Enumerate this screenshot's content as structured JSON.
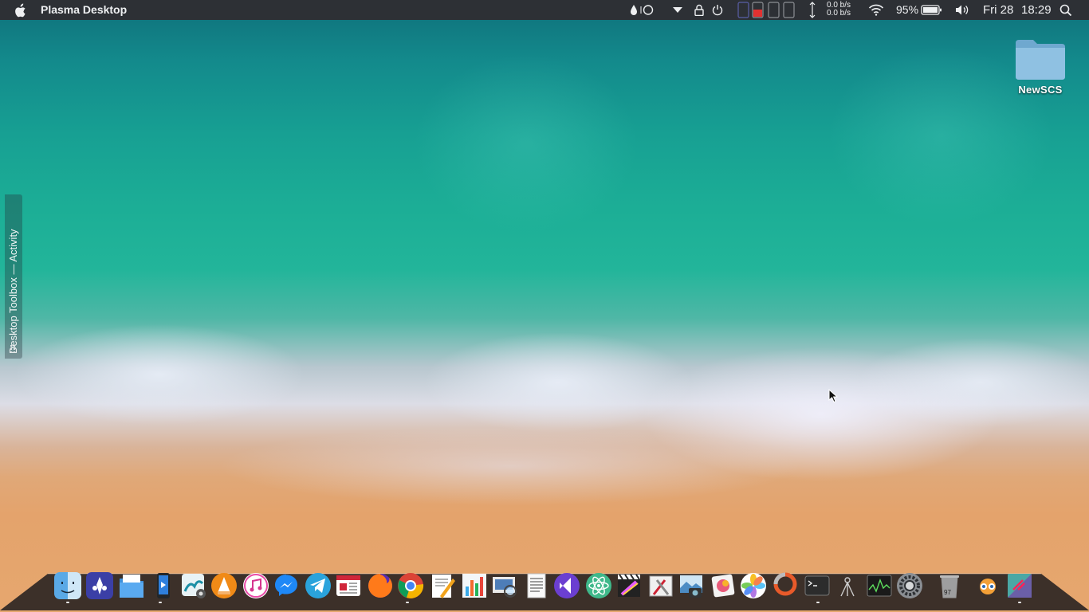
{
  "menubar": {
    "app_name": "Plasma Desktop",
    "battery_percent": "95%",
    "date": "Fri 28",
    "time": "18:29",
    "net_up": "0.0 b/s",
    "net_down": "0.0 b/s"
  },
  "toolbox": {
    "label": "Desktop Toolbox — Activity"
  },
  "desktop": {
    "folder_label": "NewSCS"
  },
  "dock": {
    "icons": [
      "finder-icon",
      "krita-icon",
      "files-icon",
      "kdeconnect-icon",
      "wallpaper-icon",
      "vlc-icon",
      "itunes-icon",
      "messenger-icon",
      "telegram-icon",
      "news-icon",
      "firefox-icon",
      "chrome-icon",
      "pages-icon",
      "numbers-icon",
      "preview-icon",
      "textedit-icon",
      "visual-studio-icon",
      "atom-icon",
      "final-cut-icon",
      "tools-icon",
      "image-capture-icon",
      "pixel-icon",
      "photos-icon",
      "photocape-icon",
      "terminal-icon",
      "system-monitor-icon",
      "activity-monitor-icon",
      "system-preferences-icon",
      "trash-icon",
      "blender-icon",
      "flathub-icon"
    ],
    "trash_count": "97"
  },
  "colors": {
    "menubar": "#2d3035",
    "battery_low_red": "#e23131"
  }
}
